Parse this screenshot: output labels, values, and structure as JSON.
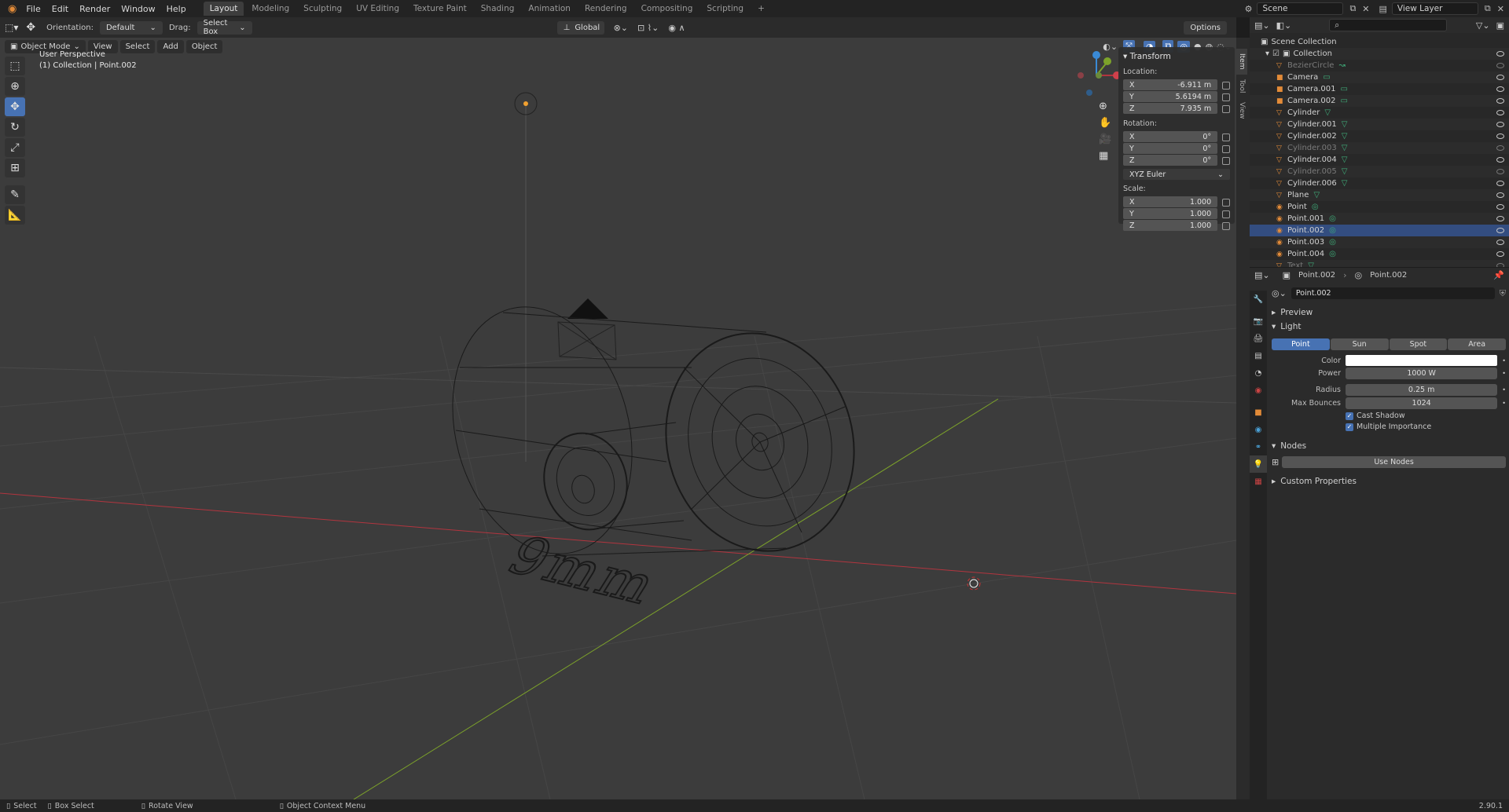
{
  "topbar": {
    "menus": [
      "File",
      "Edit",
      "Render",
      "Window",
      "Help"
    ],
    "workspaces": [
      "Layout",
      "Modeling",
      "Sculpting",
      "UV Editing",
      "Texture Paint",
      "Shading",
      "Animation",
      "Rendering",
      "Compositing",
      "Scripting"
    ],
    "active_workspace": "Layout",
    "add_tab": "+",
    "scene": "Scene",
    "view_layer": "View Layer"
  },
  "toolheader": {
    "orientation_label": "Orientation:",
    "orientation_value": "Default",
    "drag_label": "Drag:",
    "drag_value": "Select Box",
    "transform_space": "Global",
    "options": "Options"
  },
  "viewport_header": {
    "mode": "Object Mode",
    "menus": [
      "View",
      "Select",
      "Add",
      "Object"
    ]
  },
  "viewport": {
    "perspective_label": "User Perspective",
    "collection_label": "(1) Collection | Point.002",
    "text_object": "9mm"
  },
  "npanel": {
    "title": "Transform",
    "location_label": "Location:",
    "location": [
      {
        "axis": "X",
        "value": "-6.911 m"
      },
      {
        "axis": "Y",
        "value": "5.6194 m"
      },
      {
        "axis": "Z",
        "value": "7.935 m"
      }
    ],
    "rotation_label": "Rotation:",
    "rotation": [
      {
        "axis": "X",
        "value": "0°"
      },
      {
        "axis": "Y",
        "value": "0°"
      },
      {
        "axis": "Z",
        "value": "0°"
      }
    ],
    "rotation_mode": "XYZ Euler",
    "scale_label": "Scale:",
    "scale": [
      {
        "axis": "X",
        "value": "1.000"
      },
      {
        "axis": "Y",
        "value": "1.000"
      },
      {
        "axis": "Z",
        "value": "1.000"
      }
    ],
    "tabs": [
      "Item",
      "Tool",
      "View"
    ]
  },
  "outliner": {
    "scene_collection": "Scene Collection",
    "collection": "Collection",
    "items": [
      {
        "name": "BezierCircle",
        "dim": true,
        "icon": "curve"
      },
      {
        "name": "Camera",
        "dim": false,
        "icon": "camera"
      },
      {
        "name": "Camera.001",
        "dim": false,
        "icon": "camera"
      },
      {
        "name": "Camera.002",
        "dim": false,
        "icon": "camera"
      },
      {
        "name": "Cylinder",
        "dim": false,
        "icon": "mesh"
      },
      {
        "name": "Cylinder.001",
        "dim": false,
        "icon": "mesh"
      },
      {
        "name": "Cylinder.002",
        "dim": false,
        "icon": "mesh"
      },
      {
        "name": "Cylinder.003",
        "dim": true,
        "icon": "mesh"
      },
      {
        "name": "Cylinder.004",
        "dim": false,
        "icon": "mesh"
      },
      {
        "name": "Cylinder.005",
        "dim": true,
        "icon": "mesh"
      },
      {
        "name": "Cylinder.006",
        "dim": false,
        "icon": "mesh"
      },
      {
        "name": "Plane",
        "dim": false,
        "icon": "mesh"
      },
      {
        "name": "Point",
        "dim": false,
        "icon": "light"
      },
      {
        "name": "Point.001",
        "dim": false,
        "icon": "light"
      },
      {
        "name": "Point.002",
        "dim": false,
        "icon": "light",
        "selected": true
      },
      {
        "name": "Point.003",
        "dim": false,
        "icon": "light"
      },
      {
        "name": "Point.004",
        "dim": false,
        "icon": "light"
      },
      {
        "name": "Text",
        "dim": true,
        "icon": "text"
      }
    ]
  },
  "properties": {
    "breadcrumb_object": "Point.002",
    "breadcrumb_data": "Point.002",
    "datablock_name": "Point.002",
    "preview": "Preview",
    "light_section": "Light",
    "light_types": [
      "Point",
      "Sun",
      "Spot",
      "Area"
    ],
    "active_light_type": "Point",
    "color_label": "Color",
    "power_label": "Power",
    "power_value": "1000 W",
    "radius_label": "Radius",
    "radius_value": "0.25 m",
    "max_bounces_label": "Max Bounces",
    "max_bounces_value": "1024",
    "cast_shadow": "Cast Shadow",
    "multiple_importance": "Multiple Importance",
    "nodes_section": "Nodes",
    "use_nodes": "Use Nodes",
    "custom_props": "Custom Properties"
  },
  "statusbar": {
    "select": "Select",
    "box_select": "Box Select",
    "rotate_view": "Rotate View",
    "context_menu": "Object Context Menu",
    "version": "2.90.1"
  },
  "colors": {
    "accent": "#4772b3",
    "x_axis": "#b2353f",
    "y_axis": "#7da32a",
    "z_axis": "#3a8ad6",
    "viewport_bg": "#3c3c3c"
  }
}
